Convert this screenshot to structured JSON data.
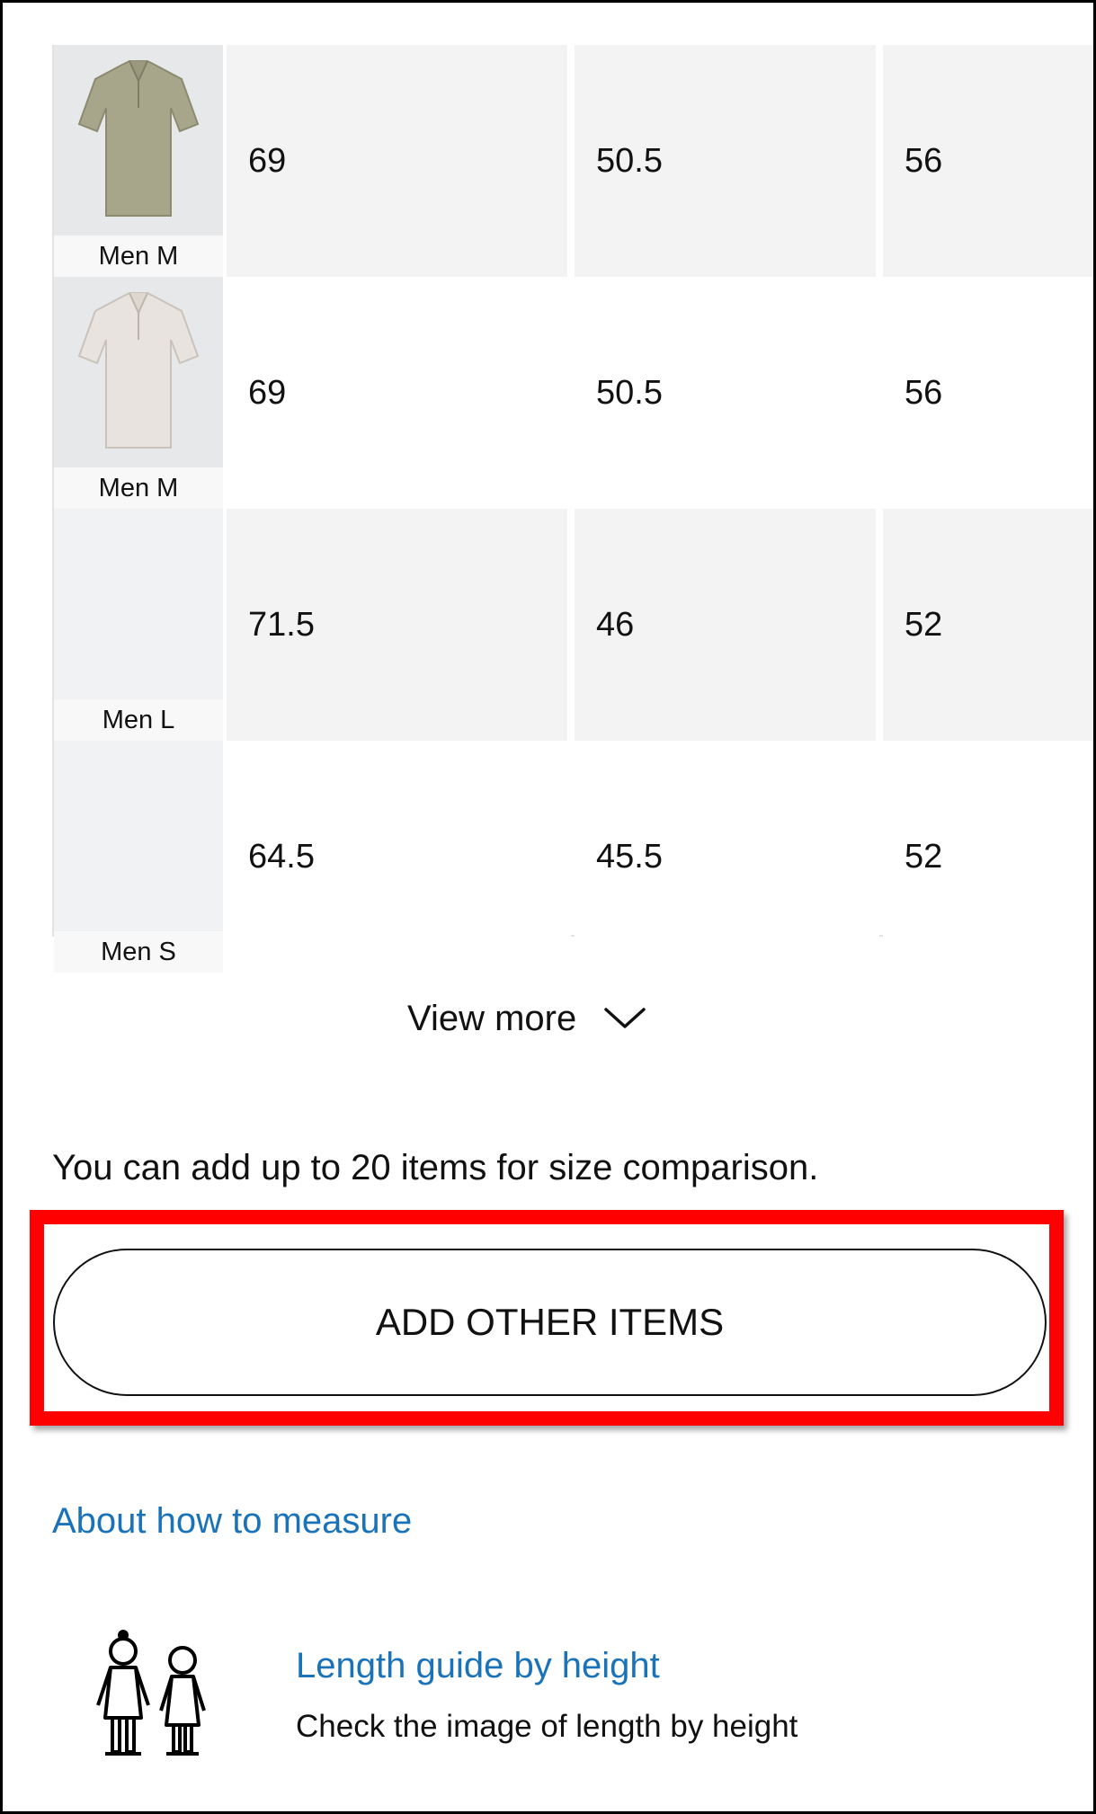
{
  "table": {
    "rows": [
      {
        "size_label": "Men M",
        "thumbnail": "polo-shirt-khaki-thumbnail",
        "shirt_color": "#a7a58a",
        "values": [
          "69",
          "50.5",
          "56"
        ]
      },
      {
        "size_label": "Men M",
        "thumbnail": "polo-shirt-off-white-thumbnail",
        "shirt_color": "#e8e3de",
        "values": [
          "69",
          "50.5",
          "56"
        ]
      },
      {
        "size_label": "Men L",
        "thumbnail": "",
        "values": [
          "71.5",
          "46",
          "52"
        ]
      },
      {
        "size_label": "Men S",
        "thumbnail": "",
        "values": [
          "64.5",
          "45.5",
          "52"
        ]
      }
    ]
  },
  "view_more": {
    "label": "View more",
    "icon": "chevron-down-icon"
  },
  "compare_note": "You can add up to 20 items for size comparison.",
  "add_button": {
    "label": "ADD OTHER ITEMS",
    "highlight_color": "#ff0000"
  },
  "links": {
    "measure": "About how to measure",
    "length_guide_title": "Length guide by height",
    "length_guide_subtitle": "Check the image of length by height",
    "length_guide_icon": "people-height-icon",
    "link_color": "#1a73b8"
  }
}
